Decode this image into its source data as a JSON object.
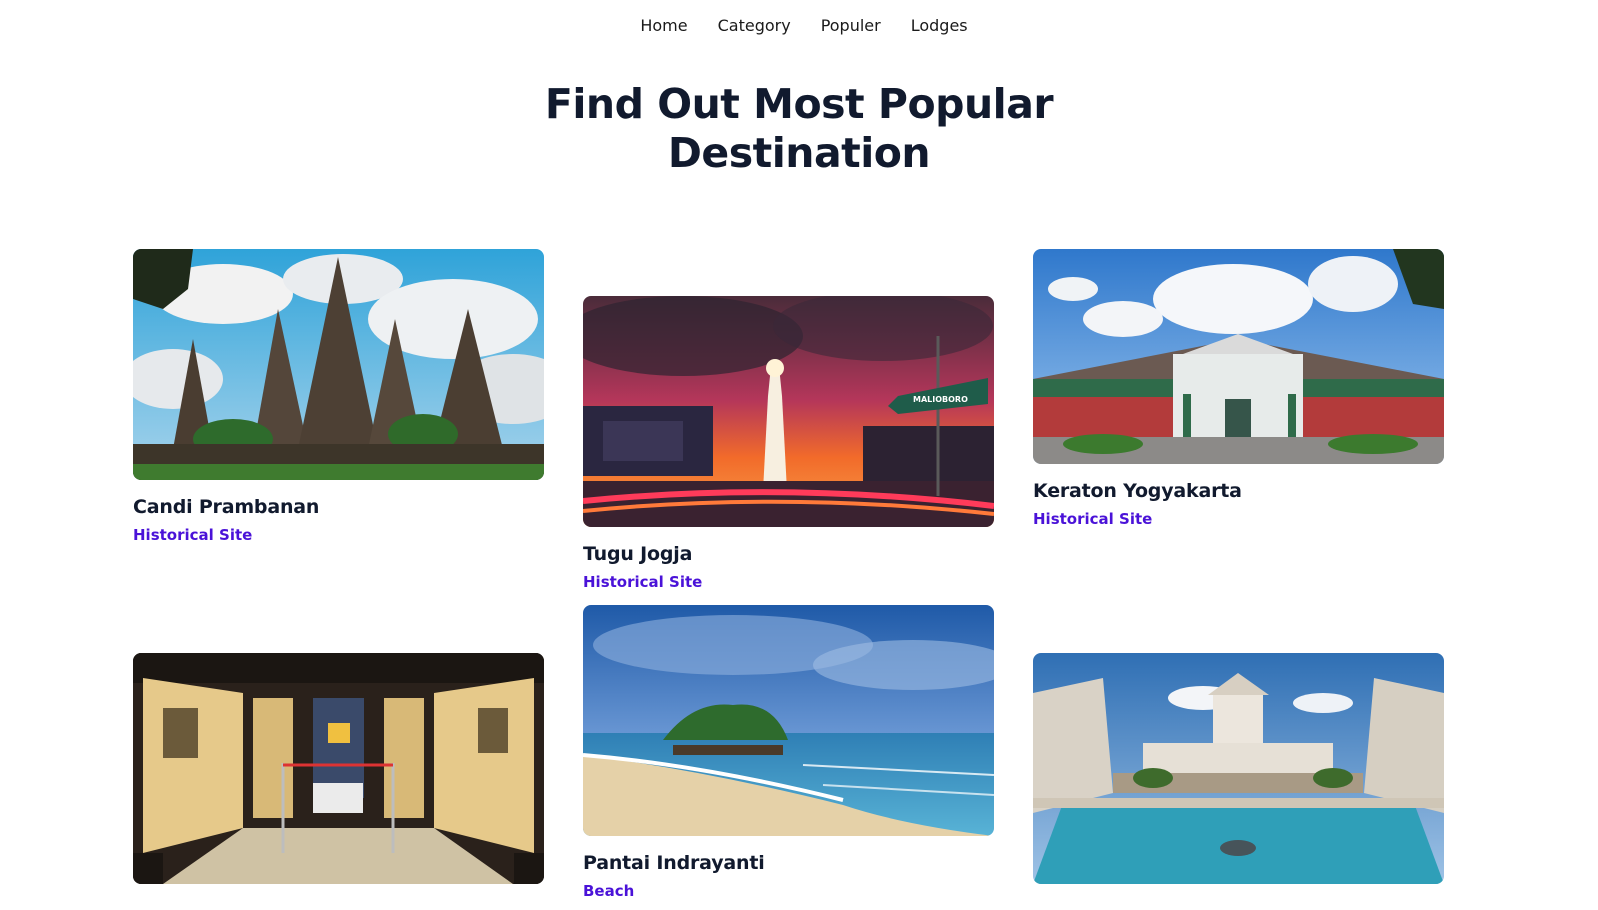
{
  "nav": {
    "items": [
      "Home",
      "Category",
      "Populer",
      "Lodges"
    ]
  },
  "hero": {
    "line1": "Find Out Most Popular",
    "line2": "Destination"
  },
  "destinations": [
    {
      "title": "Candi Prambanan",
      "category": "Historical Site"
    },
    {
      "title": "Tugu Jogja",
      "category": "Historical Site"
    },
    {
      "title": "Keraton Yogyakarta",
      "category": "Historical Site"
    },
    {
      "title": "",
      "category": ""
    },
    {
      "title": "Pantai Indrayanti",
      "category": "Beach"
    },
    {
      "title": "",
      "category": ""
    }
  ],
  "signs": {
    "malioboro": "MALIOBORO"
  },
  "colors": {
    "heading": "#111a2e",
    "category": "#4a12d8",
    "background": "#ffffff"
  }
}
